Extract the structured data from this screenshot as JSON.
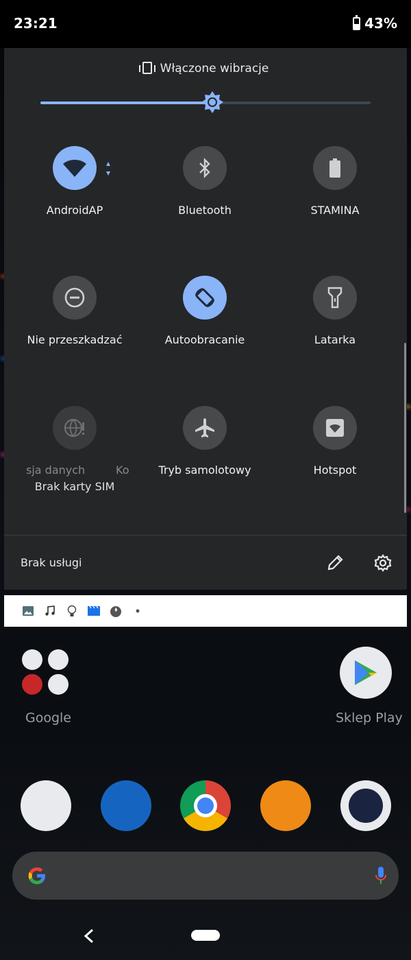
{
  "status_bar": {
    "time": "23:21",
    "battery": "43%"
  },
  "quick_settings": {
    "sound_mode": "Włączone wibracje",
    "brightness_percent": 52,
    "tiles": [
      {
        "label": "AndroidAP",
        "icon": "wifi-icon",
        "state": "on"
      },
      {
        "label": "Bluetooth",
        "icon": "bluetooth-icon",
        "state": "off"
      },
      {
        "label": "STAMINA",
        "icon": "battery-saver-icon",
        "state": "off"
      },
      {
        "label": "Nie przeszkadzać",
        "icon": "do-not-disturb-icon",
        "state": "off"
      },
      {
        "label": "Autoobracanie",
        "icon": "auto-rotate-icon",
        "state": "on"
      },
      {
        "label": "Latarka",
        "icon": "flashlight-icon",
        "state": "off"
      },
      {
        "label": "sja danych",
        "label_right": "Ko",
        "sublabel": "Brak karty SIM",
        "icon": "mobile-data-icon",
        "state": "unavailable"
      },
      {
        "label": "Tryb samolotowy",
        "icon": "airplane-icon",
        "state": "off"
      },
      {
        "label": "Hotspot",
        "icon": "hotspot-icon",
        "state": "off"
      }
    ],
    "footer": {
      "service_text": "Brak usługi"
    }
  },
  "notification_icons": [
    "photo-icon",
    "music-icon",
    "bulb-icon",
    "clapper-icon",
    "flame-icon",
    "dot-icon"
  ],
  "home": {
    "folder_label": "Google",
    "play_label": "Sklep Play",
    "dock": [
      "phone-app-icon",
      "messages-app-icon",
      "chrome-app-icon",
      "gallery-app-icon",
      "camera-app-icon"
    ]
  },
  "colors": {
    "accent": "#8ab4f8",
    "panel": "#252628",
    "tile_off": "#48494b"
  }
}
